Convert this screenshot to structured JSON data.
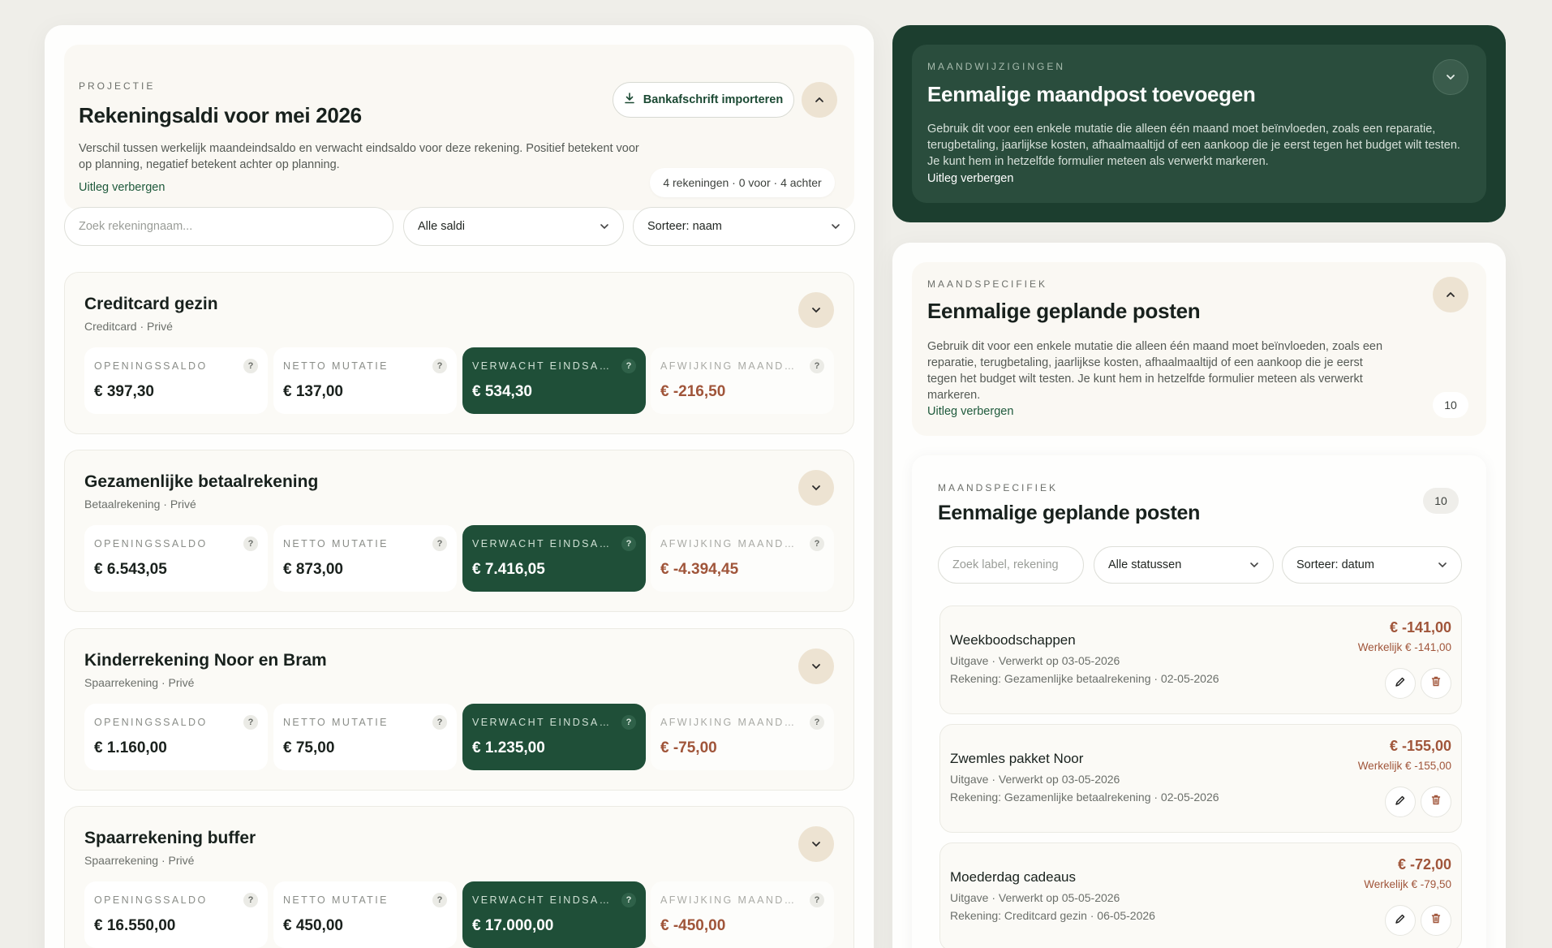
{
  "projection": {
    "eyebrow": "PROJECTIE",
    "title": "Rekeningsaldi voor mei 2026",
    "description_line1": "Verschil tussen werkelijk maandeindsaldo en verwacht eindsaldo voor deze rekening. Positief betekent voor",
    "description_line2": "op planning, negatief betekent achter op planning.",
    "hide_explanation": "Uitleg verbergen",
    "import_button": "Bankafschrift importeren",
    "summary": "4 rekeningen · 0 voor · 4 achter"
  },
  "filters": {
    "search_placeholder": "Zoek rekeningnaam...",
    "balance_filter": "Alle saldi",
    "sort": "Sorteer: naam"
  },
  "metric_labels": {
    "opening": "OPENINGSSALDO",
    "net": "NETTO MUTATIE",
    "expected": "VERWACHT EINDSALDO",
    "deviation": "AFWIJKING MAANDEINDSALDO",
    "help": "?"
  },
  "accounts": [
    {
      "name": "Creditcard gezin",
      "subtitle": "Creditcard · Privé",
      "opening": "€ 397,30",
      "net": "€ 137,00",
      "expected": "€ 534,30",
      "deviation": "€ -216,50"
    },
    {
      "name": "Gezamenlijke betaalrekening",
      "subtitle": "Betaalrekening · Privé",
      "opening": "€ 6.543,05",
      "net": "€ 873,00",
      "expected": "€ 7.416,05",
      "deviation": "€ -4.394,45"
    },
    {
      "name": "Kinderrekening Noor en Bram",
      "subtitle": "Spaarrekening · Privé",
      "opening": "€ 1.160,00",
      "net": "€ 75,00",
      "expected": "€ 1.235,00",
      "deviation": "€ -75,00"
    },
    {
      "name": "Spaarrekening buffer",
      "subtitle": "Spaarrekening · Privé",
      "opening": "€ 16.550,00",
      "net": "€ 450,00",
      "expected": "€ 17.000,00",
      "deviation": "€ -450,00"
    }
  ],
  "month_changes": {
    "eyebrow": "MAANDWIJZIGINGEN",
    "title": "Eenmalige maandpost toevoegen",
    "description_line1": "Gebruik dit voor een enkele mutatie die alleen één maand moet beïnvloeden, zoals een reparatie,",
    "description_line2": "terugbetaling, jaarlijkse kosten, afhaalmaaltijd of een aankoop die je eerst tegen het budget wilt testen.",
    "description_line3": "Je kunt hem in hetzelfde formulier meteen als verwerkt markeren.",
    "hide_explanation": "Uitleg verbergen"
  },
  "month_specific": {
    "eyebrow": "MAANDSPECIFIEK",
    "title": "Eenmalige geplande posten",
    "description_line1": "Gebruik dit voor een enkele mutatie die alleen één maand moet beïnvloeden, zoals een",
    "description_line2": "reparatie, terugbetaling, jaarlijkse kosten, afhaalmaaltijd of een aankoop die je eerst",
    "description_line3": "tegen het budget wilt testen. Je kunt hem in hetzelfde formulier meteen als verwerkt",
    "description_line4": "markeren.",
    "hide_explanation": "Uitleg verbergen",
    "count": "10"
  },
  "planned_list": {
    "eyebrow": "MAANDSPECIFIEK",
    "title": "Eenmalige geplande posten",
    "count": "10",
    "search_placeholder": "Zoek label, rekening",
    "status_filter": "Alle statussen",
    "sort": "Sorteer: datum",
    "items": [
      {
        "title": "Weekboodschappen",
        "meta": "Uitgave · Verwerkt op 03-05-2026",
        "account": "Rekening: Gezamenlijke betaalrekening · 02-05-2026",
        "amount": "€ -141,00",
        "actual": "Werkelijk € -141,00"
      },
      {
        "title": "Zwemles pakket Noor",
        "meta": "Uitgave · Verwerkt op 03-05-2026",
        "account": "Rekening: Gezamenlijke betaalrekening · 02-05-2026",
        "amount": "€ -155,00",
        "actual": "Werkelijk € -155,00"
      },
      {
        "title": "Moederdag cadeaus",
        "meta": "Uitgave · Verwerkt op 05-05-2026",
        "account": "Rekening: Creditcard gezin · 06-05-2026",
        "amount": "€ -72,00",
        "actual": "Werkelijk € -79,50"
      }
    ]
  },
  "colors": {
    "accent_dark_green": "#1f4f38",
    "negative": "#a0553a",
    "panel_dark": "#1c3e2f"
  }
}
